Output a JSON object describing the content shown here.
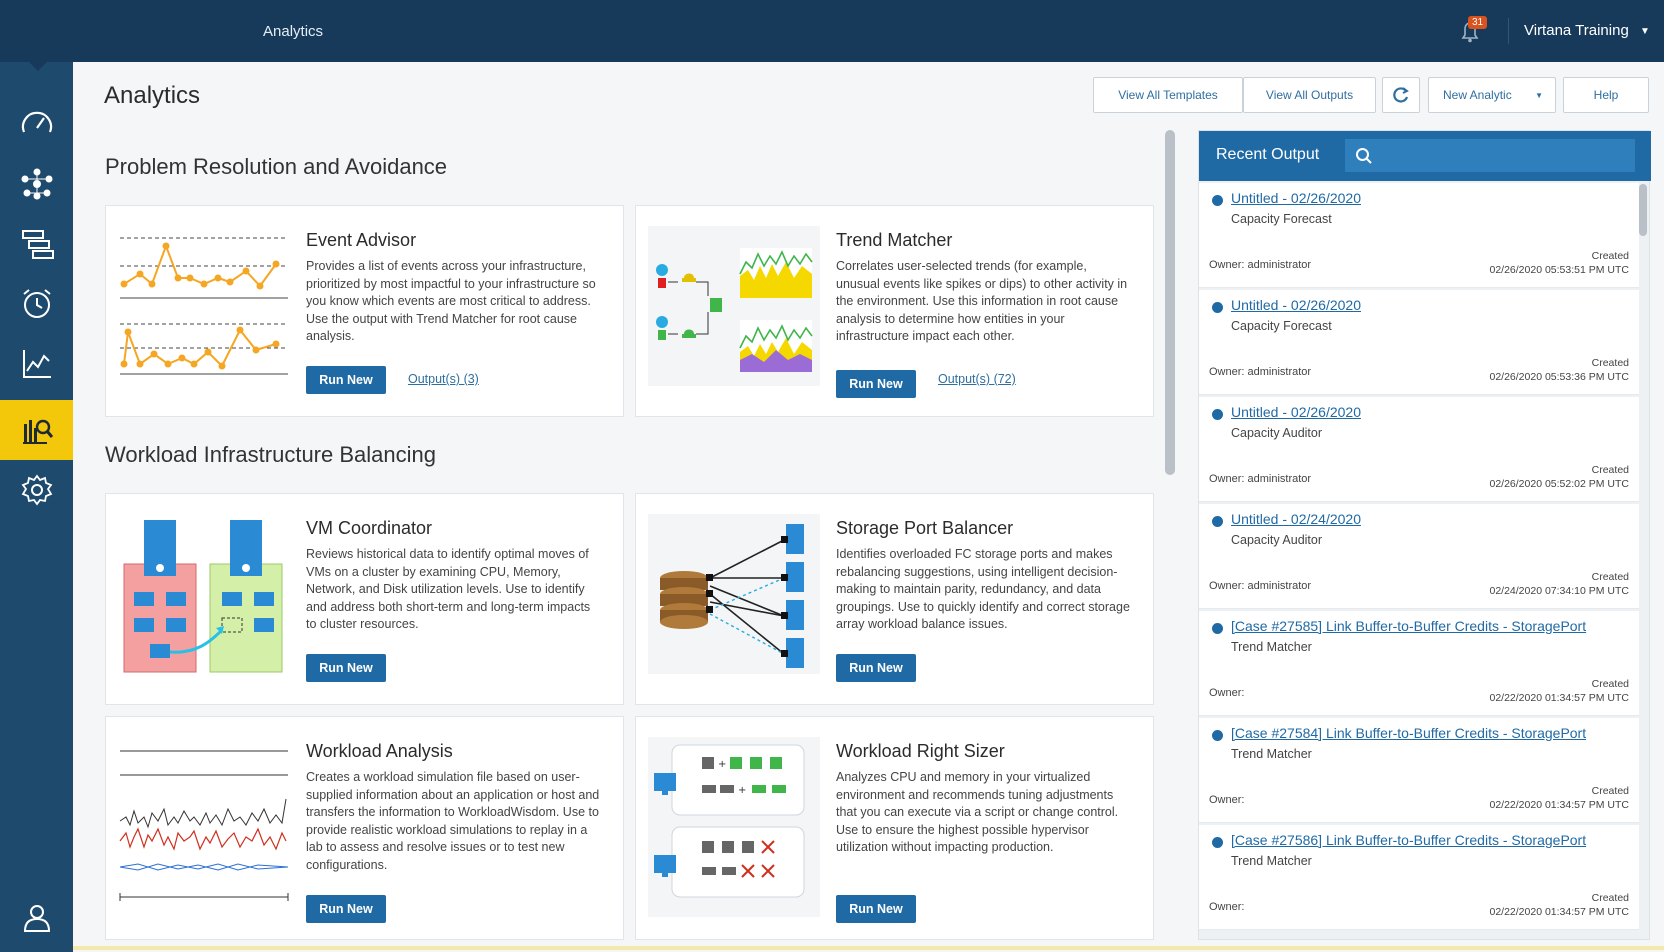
{
  "topbar": {
    "title": "Analytics",
    "notification_count": "31",
    "user": "Virtana Training"
  },
  "sidebar": {
    "items": [
      {
        "icon": "speedometer-icon"
      },
      {
        "icon": "network-topology-icon"
      },
      {
        "icon": "hierarchy-icon"
      },
      {
        "icon": "alarm-clock-icon"
      },
      {
        "icon": "line-chart-icon"
      },
      {
        "icon": "analytics-icon",
        "active": true
      },
      {
        "icon": "gear-icon"
      },
      {
        "icon": "user-icon"
      }
    ]
  },
  "header": {
    "title": "Analytics",
    "view_templates": "View All Templates",
    "view_outputs": "View All Outputs",
    "new_analytic": "New Analytic",
    "help": "Help"
  },
  "sections": {
    "problem": "Problem Resolution and Avoidance",
    "workload": "Workload Infrastructure Balancing"
  },
  "cards": {
    "event_advisor": {
      "title": "Event Advisor",
      "desc": "Provides a list of events across your infrastructure, prioritized by most impactful to your infrastructure so you know which events are most critical to address. Use the output with Trend Matcher for root cause analysis.",
      "run": "Run New",
      "outputs": "Output(s) (3)"
    },
    "trend_matcher": {
      "title": "Trend Matcher",
      "desc": "Correlates user-selected trends (for example, unusual events like spikes or dips) to other activity in the environment. Use this information in root cause analysis to determine how entities in your infrastructure impact each other.",
      "run": "Run New",
      "outputs": "Output(s) (72)"
    },
    "vm_coordinator": {
      "title": "VM Coordinator",
      "desc": "Reviews historical data to identify optimal moves of VMs on a cluster by examining CPU, Memory, Network, and Disk utilization levels. Use to identify and address both short-term and long-term impacts to cluster resources.",
      "run": "Run New"
    },
    "storage_port_balancer": {
      "title": "Storage Port Balancer",
      "desc": "Identifies overloaded FC storage ports and makes rebalancing suggestions, using intelligent decision-making to maintain parity, redundancy, and data groupings. Use to quickly identify and correct storage array workload balance issues.",
      "run": "Run New"
    },
    "workload_analysis": {
      "title": "Workload Analysis",
      "desc": "Creates a workload simulation file based on user-supplied information about an application or host and transfers the information to WorkloadWisdom. Use to provide realistic workload simulations to replay in a lab to assess and resolve issues or to test new configurations.",
      "run": "Run New"
    },
    "workload_right_sizer": {
      "title": "Workload Right Sizer",
      "desc": "Analyzes CPU and memory in your virtualized environment and recommends tuning adjustments that you can execute via a script or change control. Use to ensure the highest possible hypervisor utilization without impacting production.",
      "run": "Run New"
    }
  },
  "recent": {
    "title": "Recent Output",
    "items": [
      {
        "name": "Untitled - 02/26/2020",
        "type": "Capacity Forecast",
        "owner": "Owner: administrator",
        "created_label": "Created",
        "created": "02/26/2020 05:53:51 PM UTC"
      },
      {
        "name": "Untitled - 02/26/2020",
        "type": "Capacity Forecast",
        "owner": "Owner: administrator",
        "created_label": "Created",
        "created": "02/26/2020 05:53:36 PM UTC"
      },
      {
        "name": "Untitled - 02/26/2020",
        "type": "Capacity Auditor",
        "owner": "Owner: administrator",
        "created_label": "Created",
        "created": "02/26/2020 05:52:02 PM UTC"
      },
      {
        "name": "Untitled - 02/24/2020",
        "type": "Capacity Auditor",
        "owner": "Owner: administrator",
        "created_label": "Created",
        "created": "02/24/2020 07:34:10 PM UTC"
      },
      {
        "name": "[Case #27585] Link Buffer-to-Buffer Credits - StoragePort",
        "type": "Trend Matcher",
        "owner": "Owner:",
        "created_label": "Created",
        "created": "02/22/2020 01:34:57 PM UTC"
      },
      {
        "name": "[Case #27584] Link Buffer-to-Buffer Credits - StoragePort",
        "type": "Trend Matcher",
        "owner": "Owner:",
        "created_label": "Created",
        "created": "02/22/2020 01:34:57 PM UTC"
      },
      {
        "name": "[Case #27586] Link Buffer-to-Buffer Credits - StoragePort",
        "type": "Trend Matcher",
        "owner": "Owner:",
        "created_label": "Created",
        "created": "02/22/2020 01:34:57 PM UTC"
      }
    ]
  },
  "colors": {
    "topbar": "#173a5a",
    "sidebar": "#1e4a6e",
    "active": "#f3c80a",
    "primary": "#1f6aa5"
  }
}
